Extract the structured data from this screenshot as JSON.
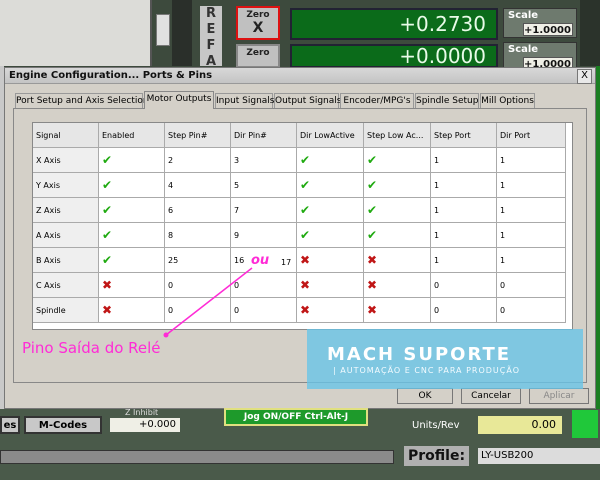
{
  "background": {
    "ref_letters": [
      "R",
      "E",
      "F",
      "A"
    ],
    "zero_buttons": [
      {
        "label": "Zero",
        "axis": "X"
      },
      {
        "label": "Zero",
        "axis": "Y"
      }
    ],
    "dros": [
      "+0.2730",
      "+0.0000"
    ],
    "scale_label": "Scale",
    "scale_values": [
      "+1.0000",
      "+1.0000"
    ],
    "bottom": {
      "left_btn": "es",
      "mcodes_btn": "M-Codes",
      "inches_label": "Z Inhibit",
      "value": "+0.000",
      "jog_btn": "Jog ON/OFF Ctrl-Alt-J",
      "units_label": "Units/Rev",
      "units_value": "0.00",
      "profile_label": "Profile:",
      "profile_value": "LY-USB200"
    }
  },
  "dialog": {
    "title": "Engine Configuration... Ports & Pins",
    "close": "X",
    "tabs": [
      "Port Setup and Axis Selection",
      "Motor Outputs",
      "Input Signals",
      "Output Signals",
      "Encoder/MPG's",
      "Spindle Setup",
      "Mill Options"
    ],
    "active_tab": "Motor Outputs",
    "columns": [
      "Signal",
      "Enabled",
      "Step Pin#",
      "Dir Pin#",
      "Dir LowActive",
      "Step Low Ac...",
      "Step Port",
      "Dir Port"
    ],
    "rows": [
      {
        "signal": "X Axis",
        "enabled": true,
        "step_pin": "2",
        "dir_pin": "3",
        "dir_low": true,
        "step_low": true,
        "step_port": "1",
        "dir_port": "1"
      },
      {
        "signal": "Y Axis",
        "enabled": true,
        "step_pin": "4",
        "dir_pin": "5",
        "dir_low": true,
        "step_low": true,
        "step_port": "1",
        "dir_port": "1"
      },
      {
        "signal": "Z Axis",
        "enabled": true,
        "step_pin": "6",
        "dir_pin": "7",
        "dir_low": true,
        "step_low": true,
        "step_port": "1",
        "dir_port": "1"
      },
      {
        "signal": "A Axis",
        "enabled": true,
        "step_pin": "8",
        "dir_pin": "9",
        "dir_low": true,
        "step_low": true,
        "step_port": "1",
        "dir_port": "1"
      },
      {
        "signal": "B Axis",
        "enabled": true,
        "step_pin": "25",
        "dir_pin": "16",
        "dir_low": false,
        "step_low": false,
        "step_port": "1",
        "dir_port": "1"
      },
      {
        "signal": "C Axis",
        "enabled": false,
        "step_pin": "0",
        "dir_pin": "0",
        "dir_low": false,
        "step_low": false,
        "step_port": "0",
        "dir_port": "0"
      },
      {
        "signal": "Spindle",
        "enabled": false,
        "step_pin": "0",
        "dir_pin": "0",
        "dir_low": false,
        "step_low": false,
        "step_port": "0",
        "dir_port": "0"
      }
    ],
    "buttons": {
      "ok": "OK",
      "cancel": "Cancelar",
      "apply": "Aplicar"
    }
  },
  "annotations": {
    "ou": "ou",
    "alt_pin": "17",
    "relay_label": "Pino Saída do Relé",
    "color": "#ff2bd6"
  },
  "watermark": {
    "title": "MACH SUPORTE",
    "subtitle": "| AUTOMAÇÃO E CNC PARA PRODUÇÃO"
  }
}
